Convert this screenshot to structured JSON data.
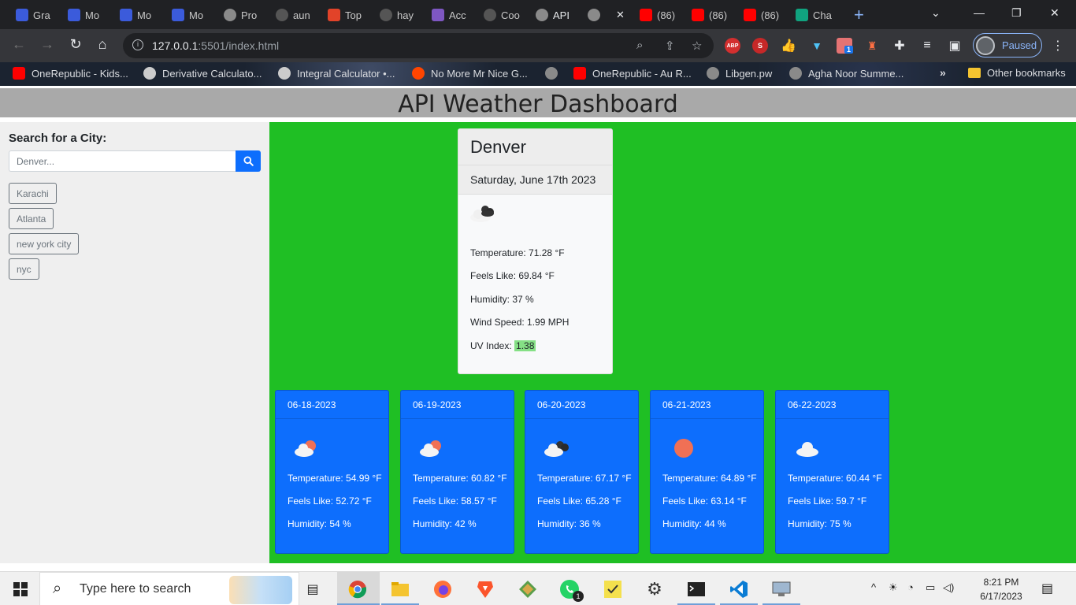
{
  "browser": {
    "tabs": [
      {
        "label": "Gra",
        "color": "#3b5bdb"
      },
      {
        "label": "Mo",
        "color": "#3b5bdb"
      },
      {
        "label": "Mo",
        "color": "#3b5bdb"
      },
      {
        "label": "Mo",
        "color": "#3b5bdb"
      },
      {
        "label": "Pro",
        "color": "#8a8a8a"
      },
      {
        "label": "aun",
        "color": "#555555"
      },
      {
        "label": "Top",
        "color": "#e24329"
      },
      {
        "label": "hay",
        "color": "#555555"
      },
      {
        "label": "Acc",
        "color": "#7e57c2"
      },
      {
        "label": "Coo",
        "color": "#555555"
      },
      {
        "label": "API",
        "color": "#8a8a8a"
      },
      {
        "label": "",
        "color": "#8a8a8a"
      },
      {
        "label": "(86)",
        "color": "#ff0000"
      },
      {
        "label": "(86)",
        "color": "#ff0000"
      },
      {
        "label": "(86)",
        "color": "#ff0000"
      },
      {
        "label": "Cha",
        "color": "#10a37f"
      }
    ],
    "url_host": "127.0.0.1",
    "url_rest": ":5501/index.html",
    "profile_label": "Paused",
    "extension_badge": "1",
    "abp_label": "ABP",
    "bookmarks": [
      {
        "label": "OneRepublic - Kids...",
        "color": "#ff0000"
      },
      {
        "label": "Derivative Calculato...",
        "color": "#cccccc"
      },
      {
        "label": "Integral Calculator •...",
        "color": "#cccccc"
      },
      {
        "label": "No More Mr Nice G...",
        "color": "#ff4500"
      },
      {
        "label": "",
        "color": "#8a8a8a"
      },
      {
        "label": "OneRepublic - Au R...",
        "color": "#ff0000"
      },
      {
        "label": "Libgen.pw",
        "color": "#8a8a8a"
      },
      {
        "label": "Agha Noor Summe...",
        "color": "#8a8a8a"
      }
    ],
    "bookmarks_more": "»",
    "other_bookmarks": "Other bookmarks"
  },
  "page": {
    "title": "API Weather Dashboard",
    "search_label": "Search for a City:",
    "search_placeholder": "Denver...",
    "history": [
      "Karachi",
      "Atlanta",
      "new york city",
      "nyc"
    ],
    "current": {
      "city": "Denver",
      "date": "Saturday, June 17th 2023",
      "icon": "dark-clouds-icon",
      "temperature": "Temperature: 71.28 °F",
      "feels_like": "Feels Like: 69.84 °F",
      "humidity": "Humidity: 37 %",
      "wind": "Wind Speed: 1.99 MPH",
      "uv_label": "UV Index:",
      "uv_value": "1.38",
      "uv_color": "#85e085"
    },
    "forecast": [
      {
        "date": "06-18-2023",
        "icon": "partly-cloudy-icon",
        "temperature": "Temperature: 54.99 °F",
        "feels_like": "Feels Like: 52.72 °F",
        "humidity": "Humidity: 54 %"
      },
      {
        "date": "06-19-2023",
        "icon": "partly-cloudy-icon",
        "temperature": "Temperature: 60.82 °F",
        "feels_like": "Feels Like: 58.57 °F",
        "humidity": "Humidity: 42 %"
      },
      {
        "date": "06-20-2023",
        "icon": "dark-clouds-icon",
        "temperature": "Temperature: 67.17 °F",
        "feels_like": "Feels Like: 65.28 °F",
        "humidity": "Humidity: 36 %"
      },
      {
        "date": "06-21-2023",
        "icon": "sun-icon",
        "temperature": "Temperature: 64.89 °F",
        "feels_like": "Feels Like: 63.14 °F",
        "humidity": "Humidity: 44 %"
      },
      {
        "date": "06-22-2023",
        "icon": "cloud-icon",
        "temperature": "Temperature: 60.44 °F",
        "feels_like": "Feels Like: 59.7 °F",
        "humidity": "Humidity: 75 %"
      }
    ],
    "colors": {
      "header_bg": "#a9a9a9",
      "sidebar_bg": "#efefef",
      "main_bg": "#1fbf24",
      "forecast_bg": "#0d6efd",
      "primary": "#0d6efd"
    }
  },
  "taskbar": {
    "search_placeholder": "Type here to search",
    "time": "8:21 PM",
    "date": "6/17/2023",
    "whatsapp_badge": "1"
  }
}
